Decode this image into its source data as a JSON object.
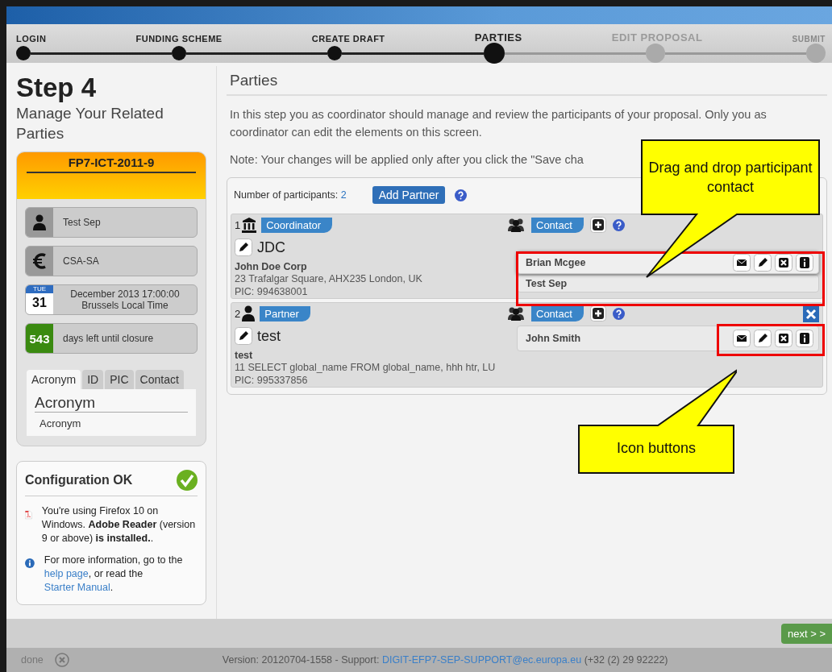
{
  "steps": [
    {
      "label": "LOGIN",
      "done": true,
      "selected": false
    },
    {
      "label": "FUNDING SCHEME",
      "done": true,
      "selected": false
    },
    {
      "label": "CREATE DRAFT",
      "done": true,
      "selected": false
    },
    {
      "label": "PARTIES",
      "done": false,
      "selected": true
    },
    {
      "label": "EDIT PROPOSAL",
      "done": false,
      "selected": false
    },
    {
      "label": "SUBMIT",
      "done": false,
      "selected": false
    }
  ],
  "sidebar": {
    "title": "Step 4",
    "subtitle": "Manage Your Related Parties",
    "call": "FP7-ICT-2011-9",
    "info": [
      {
        "kind": "person",
        "text": "Test Sep"
      },
      {
        "kind": "euro",
        "text": "CSA-SA"
      },
      {
        "kind": "calendar",
        "day": "TUE",
        "date": "31",
        "text": "December 2013 17:00:00",
        "text2": "Brussels Local Time"
      },
      {
        "kind": "counter",
        "count": "543",
        "text": "days left until closure"
      }
    ],
    "search_tabs": [
      {
        "label": "Acronym",
        "selected": true
      },
      {
        "label": "ID",
        "selected": false
      },
      {
        "label": "PIC",
        "selected": false
      },
      {
        "label": "Contact",
        "selected": false
      }
    ],
    "search_heading": "Acronym",
    "search_value": "Acronym"
  },
  "config": {
    "title": "Configuration OK",
    "message": "You're using Firefox 10 on Windows. **Adobe Reader** (version 9 or above) **is installed.**.",
    "help_before": "For more information, go to the ",
    "help_link": "help page",
    "help_middle": ", or read the ",
    "manual_link": "Starter Manual",
    "help_after": "."
  },
  "main": {
    "title": "Parties",
    "intro": "In this step you as coordinator should manage and review the participants of your proposal. Only you as coordinator can edit the elements on this screen.",
    "note": "Note: Your changes will be applied only after you click the \"Save cha",
    "participants_label": "Number of participants:",
    "participants_count": "2",
    "add_button": "Add Partner",
    "parties": [
      {
        "number": "1",
        "kind": "coordinator",
        "role": "Coordinator",
        "contact_label": "Contact",
        "acronym": "JDC",
        "name": "John Doe Corp",
        "address": "23 Trafalgar Square, AHX235 London, UK",
        "pic": "PIC: 994638001",
        "removable": false,
        "contacts": [
          {
            "name": "Brian Mcgee",
            "dragging": true
          },
          {
            "name": "Test Sep",
            "dragging": false
          }
        ]
      },
      {
        "number": "2",
        "kind": "partner",
        "role": "Partner",
        "contact_label": "Contact",
        "acronym": "test",
        "name": "test",
        "address": "11 SELECT global_name FROM global_name, hhh htr, LU",
        "pic": "PIC: 995337856",
        "removable": true,
        "contacts": [
          {
            "name": "John Smith",
            "dragging": false
          }
        ]
      }
    ]
  },
  "next_button": "next > >",
  "footer": {
    "status": "done",
    "version": "Version: 20120704-1558 - Support: ",
    "email": "DIGIT-EFP7-SEP-SUPPORT@ec.europa.eu",
    "phone": "(+32 (2) 29 92222)"
  },
  "callouts": [
    {
      "text": "Drag and drop participant contact"
    },
    {
      "text": "Icon buttons"
    }
  ]
}
